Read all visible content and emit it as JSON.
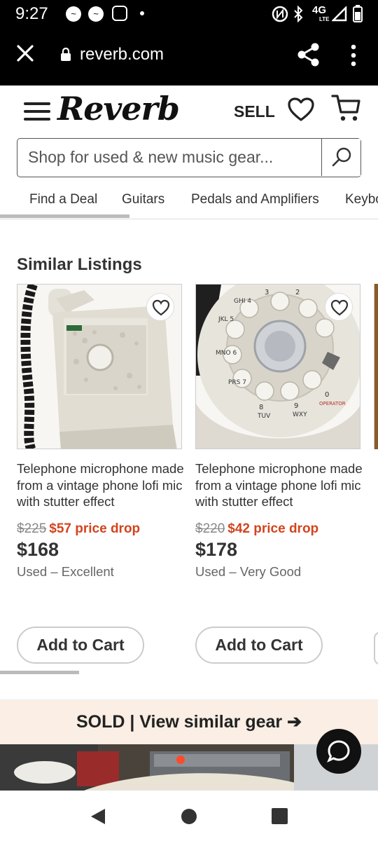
{
  "status_bar": {
    "time": "9:27",
    "network": "4G LTE"
  },
  "browser": {
    "url": "reverb.com"
  },
  "header": {
    "logo": "Reverb",
    "sell_label": "SELL"
  },
  "search": {
    "placeholder": "Shop for used & new music gear..."
  },
  "nav_tabs": [
    "Find a Deal",
    "Guitars",
    "Pedals and Amplifiers",
    "Keybo"
  ],
  "section": {
    "title": "Similar Listings"
  },
  "listings": [
    {
      "title": "Telephone microphone made from a vintage phone lofi mic with stutter effect",
      "old_price": "$225",
      "price_drop": "$57 price drop",
      "price": "$168",
      "condition": "Used – Excellent",
      "add_to_cart": "Add to Cart"
    },
    {
      "title": "Telephone microphone made from a vintage phone lofi mic with stutter effect",
      "old_price": "$220",
      "price_drop": "$42 price drop",
      "price": "$178",
      "condition": "Used – Very Good",
      "add_to_cart": "Add to Cart"
    }
  ],
  "sold_banner": {
    "text": "SOLD | View similar gear ➔"
  },
  "colors": {
    "accent": "#d2451e",
    "banner_bg": "#fbeee4"
  },
  "icons": [
    "close-icon",
    "lock-icon",
    "share-icon",
    "overflow-menu-icon",
    "hamburger-icon",
    "heart-icon",
    "cart-icon",
    "search-icon",
    "chat-icon",
    "back-icon",
    "home-icon",
    "recents-icon"
  ]
}
